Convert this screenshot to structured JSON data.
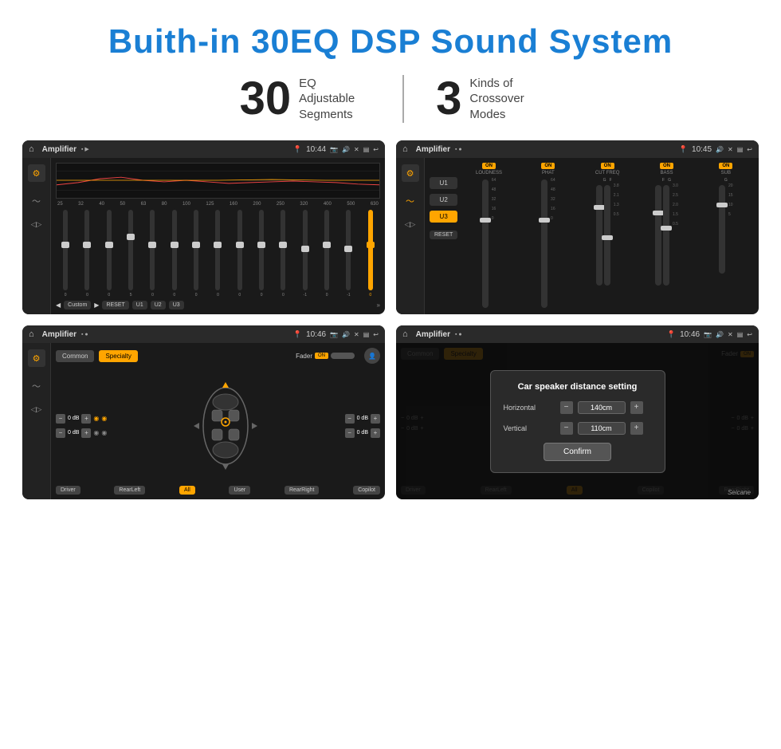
{
  "header": {
    "title": "Buith-in 30EQ DSP Sound System"
  },
  "stats": {
    "eq_number": "30",
    "eq_label_line1": "EQ Adjustable",
    "eq_label_line2": "Segments",
    "crossover_number": "3",
    "crossover_label_line1": "Kinds of",
    "crossover_label_line2": "Crossover Modes"
  },
  "screen1": {
    "topbar_title": "Amplifier",
    "time": "10:44",
    "eq_freqs": [
      "25",
      "32",
      "40",
      "50",
      "63",
      "80",
      "100",
      "125",
      "160",
      "200",
      "250",
      "320",
      "400",
      "500",
      "630"
    ],
    "eq_values": [
      "0",
      "0",
      "0",
      "0",
      "5",
      "0",
      "0",
      "0",
      "0",
      "0",
      "0",
      "0",
      "0",
      "-1",
      "0",
      "-1"
    ],
    "bottom_labels": [
      "Custom",
      "RESET",
      "U1",
      "U2",
      "U3"
    ]
  },
  "screen2": {
    "topbar_title": "Amplifier",
    "time": "10:45",
    "channels": [
      "LOUDNESS",
      "PHAT",
      "CUT FREQ",
      "BASS",
      "SUB"
    ],
    "u_buttons": [
      "U1",
      "U2",
      "U3"
    ],
    "active_u": "U3",
    "reset_label": "RESET"
  },
  "screen3": {
    "topbar_title": "Amplifier",
    "time": "10:46",
    "mode_common": "Common",
    "mode_specialty": "Specialty",
    "fader_label": "Fader",
    "fader_on": "ON",
    "db_values": [
      "0 dB",
      "0 dB",
      "0 dB",
      "0 dB"
    ],
    "speaker_positions": [
      "Driver",
      "RearLeft",
      "All",
      "User",
      "RearRight",
      "Copilot"
    ]
  },
  "screen4": {
    "topbar_title": "Amplifier",
    "time": "10:46",
    "dialog_title": "Car speaker distance setting",
    "horizontal_label": "Horizontal",
    "horizontal_value": "140cm",
    "vertical_label": "Vertical",
    "vertical_value": "110cm",
    "confirm_label": "Confirm",
    "speaker_labels": [
      "Driver",
      "RearLeft",
      "All",
      "Copilot",
      "RearRight"
    ],
    "db_values": [
      "0 dB",
      "0 dB"
    ]
  },
  "watermark": "Seicane"
}
